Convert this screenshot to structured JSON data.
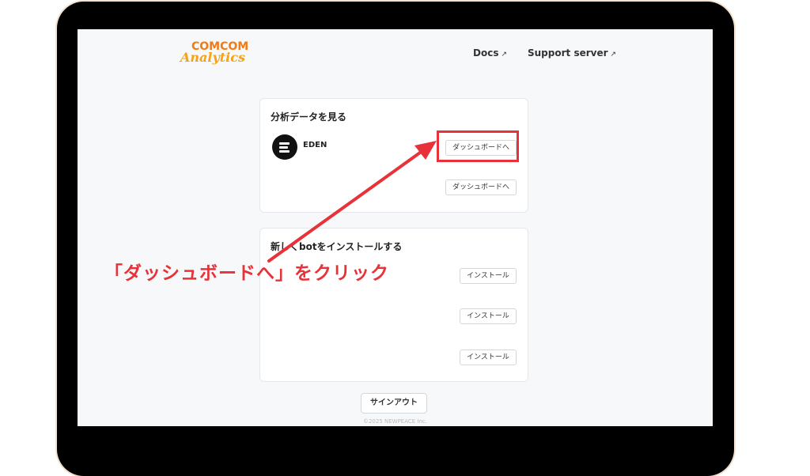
{
  "header": {
    "logo_top": "COMCOM",
    "logo_bottom": "Analytics",
    "nav": [
      {
        "label": "Docs",
        "icon": "external-link-icon"
      },
      {
        "label": "Support server",
        "icon": "external-link-icon"
      }
    ]
  },
  "analytics_card": {
    "title": "分析データを見る",
    "bot": {
      "name": "EDEN"
    },
    "dashboard_buttons": [
      "ダッシュボードへ",
      "ダッシュボードへ"
    ]
  },
  "install_card": {
    "title": "新しくbotをインストールする",
    "install_buttons": [
      "インストール",
      "インストール",
      "インストール"
    ]
  },
  "signout_label": "サインアウト",
  "footer_text": "©2025 NEWPEACE Inc.",
  "annotation": {
    "callout": "「ダッシュボードへ」をクリック",
    "color": "#e8323a"
  },
  "colors": {
    "logo_orange": "#f47a12",
    "logo_yellow": "#f4a21a",
    "background": "#f6f8fa"
  }
}
